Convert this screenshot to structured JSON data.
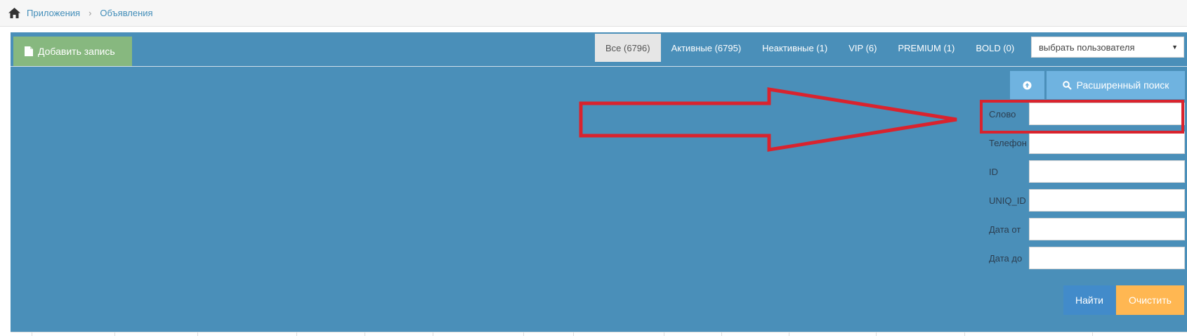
{
  "breadcrumb": {
    "home_icon": "home-icon",
    "items": [
      "Приложения",
      "Объявления"
    ],
    "separator": "›"
  },
  "toolbar": {
    "add_label": "Добавить запись",
    "add_icon": "file-icon",
    "tabs": [
      {
        "label": "Все (6796)",
        "active": true
      },
      {
        "label": "Активные (6795)"
      },
      {
        "label": "Неактивные (1)"
      },
      {
        "label": "VIP (6)"
      },
      {
        "label": "PREMIUM (1)"
      },
      {
        "label": "BOLD (0)"
      }
    ],
    "user_select": "выбрать пользователя"
  },
  "search": {
    "collapse_icon": "arrow-up-circle-icon",
    "advanced_label": "Расширенный поиск",
    "fields": [
      {
        "label": "Слово",
        "value": ""
      },
      {
        "label": "Телефон",
        "value": ""
      },
      {
        "label": "ID",
        "value": ""
      },
      {
        "label": "UNIQ_ID",
        "value": ""
      },
      {
        "label": "Дата от",
        "value": ""
      },
      {
        "label": "Дата до",
        "value": ""
      }
    ],
    "find_label": "Найти",
    "clear_label": "Очистить"
  },
  "colors": {
    "panel": "#4a8fb9",
    "add_button": "#87b87f",
    "light_button": "#6fb3e0",
    "find_button": "#428bca",
    "clear_button": "#ffb752",
    "annotation": "#d9232e"
  }
}
